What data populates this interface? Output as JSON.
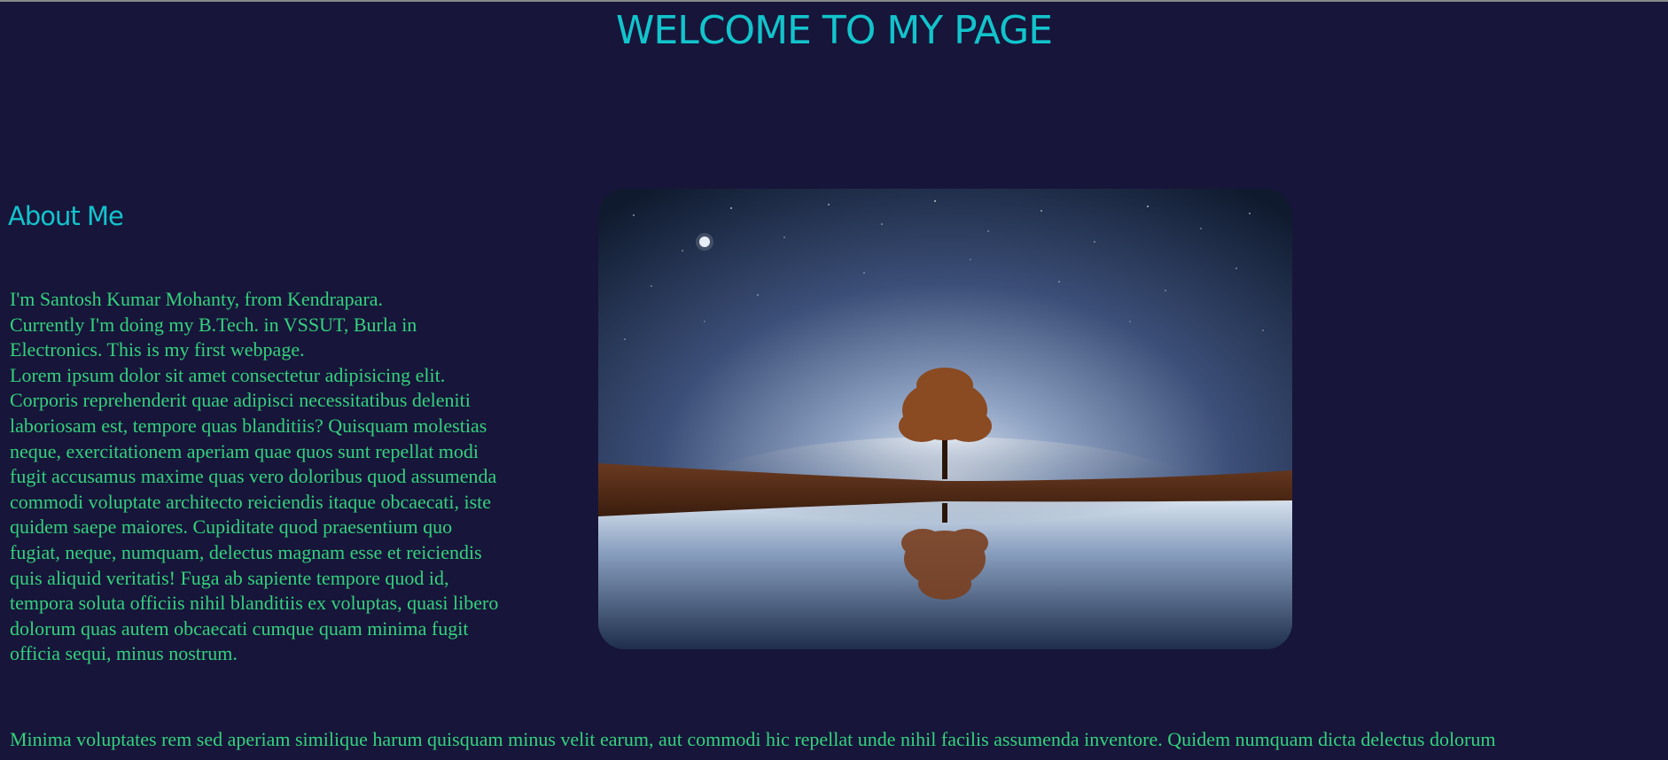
{
  "page": {
    "title": "WELCOME TO MY PAGE"
  },
  "about": {
    "heading": "About Me",
    "paragraph": "I'm Santosh Kumar Mohanty, from Kendrapara.\nCurrently I'm doing my B.Tech. in VSSUT, Burla in Electronics. This is my first webpage.\nLorem ipsum dolor sit amet consectetur adipisicing elit. Corporis reprehenderit quae adipisci necessitatibus deleniti laboriosam est, tempore quas blanditiis? Quisquam molestias neque, exercitationem aperiam quae quos sunt repellat modi fugit accusamus maxime quas vero doloribus quod assumenda commodi voluptate architecto reiciendis itaque obcaecati, iste quidem saepe maiores. Cupiditate quod praesentium quo fugiat, neque, numquam, delectus magnam esse et reiciendis quis aliquid veritatis! Fuga ab sapiente tempore quod id, tempora soluta officiis nihil blanditiis ex voluptas, quasi libero dolorum quas autem obcaecati cumque quam minima fugit officia sequi, minus nostrum."
  },
  "bottom": {
    "paragraph": "Minima voluptates rem sed aperiam similique harum quisquam minus velit earum, aut commodi hic repellat unde nihil facilis assumenda inventore. Quidem numquam dicta delectus dolorum"
  },
  "colors": {
    "background": "#17153a",
    "heading": "#12c4cc",
    "body_text": "#34d27c"
  },
  "image": {
    "icon": "night-lake-tree-photo"
  }
}
